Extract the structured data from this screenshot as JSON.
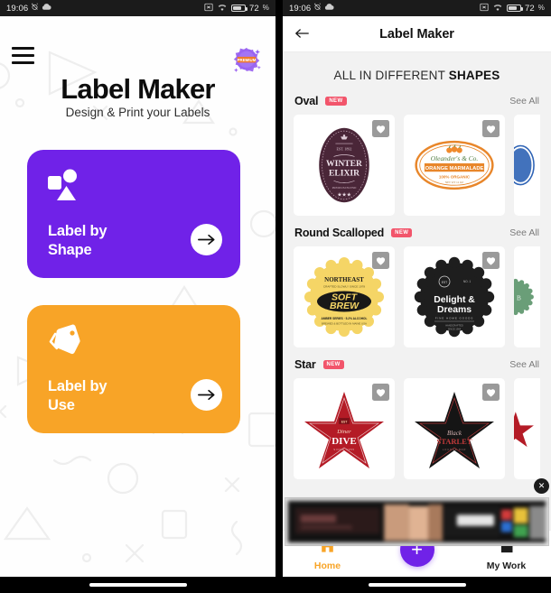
{
  "status_bar": {
    "time": "19:06",
    "battery_percent": "72",
    "icons": [
      "alarm-off-icon",
      "cloud-icon",
      "cast-icon",
      "wifi-icon",
      "battery-icon"
    ]
  },
  "left_screen": {
    "menu_icon": "hamburger-menu-icon",
    "premium_badge_label": "PREMIUM",
    "title": "Label Maker",
    "subtitle": "Design & Print your Labels",
    "cards": [
      {
        "label": "Label by\nShape",
        "label_line1": "Label by",
        "label_line2": "Shape",
        "color": "#7022E8",
        "icon": "shapes-icon",
        "arrow": "→"
      },
      {
        "label": "Label by\nUse",
        "label_line1": "Label by",
        "label_line2": "Use",
        "color": "#F8A427",
        "icon": "tag-icon",
        "arrow": "→"
      }
    ]
  },
  "right_screen": {
    "appbar": {
      "back_icon": "arrow-left-icon",
      "title": "Label Maker"
    },
    "banner_heading_normal": "ALL IN DIFFERENT ",
    "banner_heading_bold": "SHAPES",
    "see_all_label": "See All",
    "new_badge_label": "NEW",
    "sections": [
      {
        "title": "Oval",
        "badge": "NEW",
        "see_all": "See All",
        "items": [
          {
            "name": "winter-elixir-oval-label",
            "title": "WINTER ELIXIR",
            "fill": "#4A2638",
            "art": "oval-dark"
          },
          {
            "name": "oleanders-co-oval-label",
            "title": "Oleander's & Co. ORANGE MARMALADE 100% ORGANIC",
            "fill": "#E8862A",
            "art": "oval-orange"
          },
          {
            "name": "blue-oval-label",
            "title": "",
            "fill": "#2E63B5",
            "art": "oval-blue"
          }
        ]
      },
      {
        "title": "Round Scalloped",
        "badge": "NEW",
        "see_all": "See All",
        "items": [
          {
            "name": "soft-brew-scalloped-label",
            "title": "NORTHEAST SOFT BREW",
            "fill": "#F5D566",
            "art": "scallop-yellow"
          },
          {
            "name": "delight-dreams-scalloped-label",
            "title": "Delight & Dreams",
            "fill": "#1E1E1E",
            "art": "scallop-dark"
          },
          {
            "name": "green-scalloped-label",
            "title": "B",
            "fill": "#6A9E78",
            "art": "scallop-green"
          }
        ]
      },
      {
        "title": "Star",
        "badge": "NEW",
        "see_all": "See All",
        "items": [
          {
            "name": "red-star-label",
            "title": "DIVE",
            "fill": "#B41B26",
            "art": "star-red"
          },
          {
            "name": "black-star-label",
            "title": "Black",
            "fill": "#151515",
            "art": "star-black"
          },
          {
            "name": "third-star-label",
            "title": "",
            "fill": "#B41B26",
            "art": "star-red"
          }
        ]
      }
    ],
    "ad": {
      "close_label": "✕",
      "name": "advertisement-banner"
    },
    "bottom_nav": [
      {
        "label": "Home",
        "icon": "home-icon",
        "active": true
      },
      {
        "label": "My Work",
        "icon": "document-icon",
        "active": false
      }
    ],
    "fab": {
      "icon": "plus-icon",
      "label": "+"
    }
  }
}
